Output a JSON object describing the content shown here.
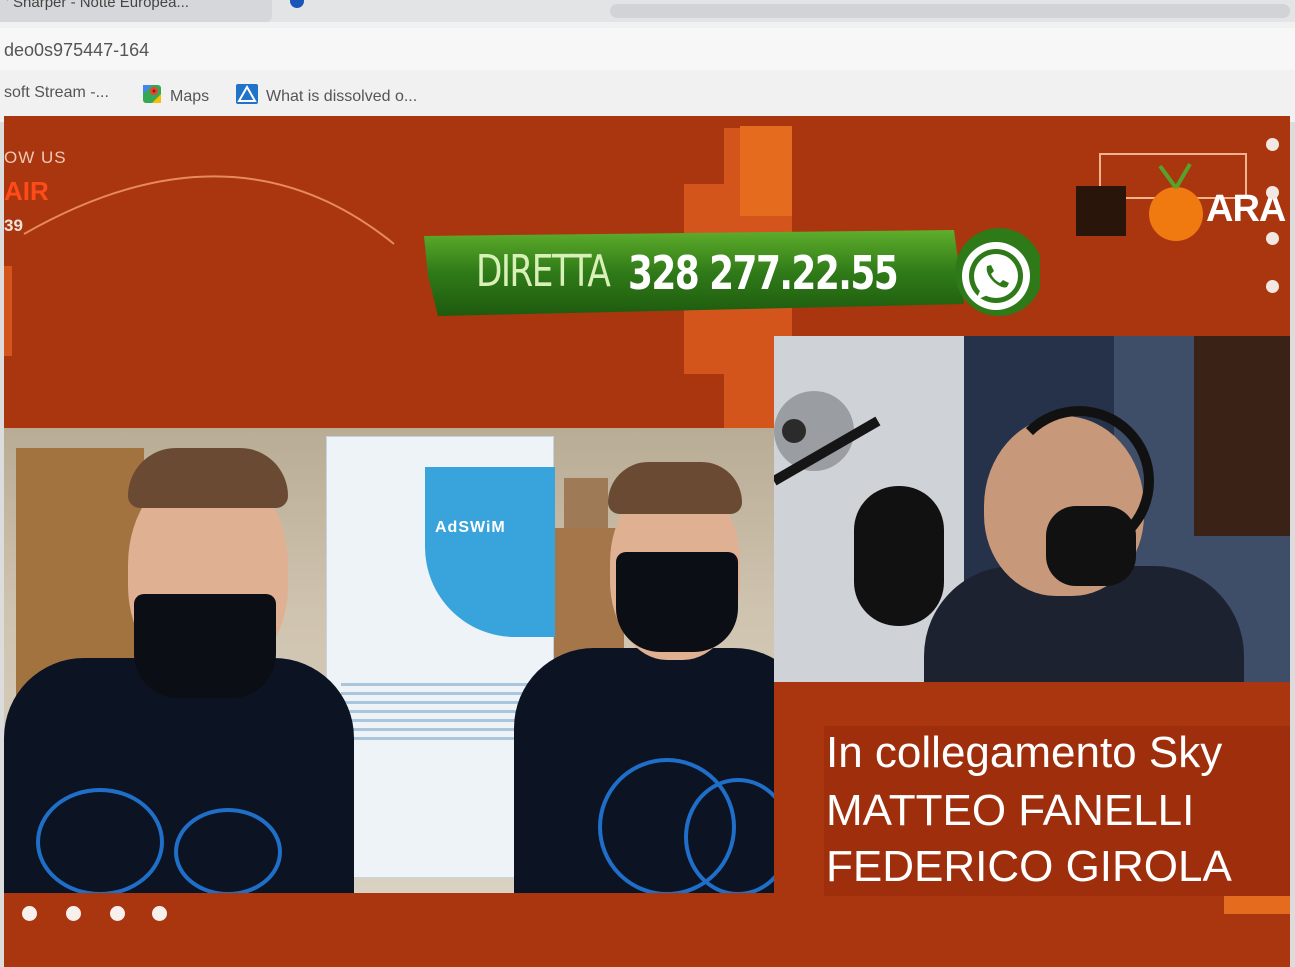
{
  "browser": {
    "tab_title": "' Sharper - Notte Europea...",
    "url": "deo0s975447-164",
    "bookmarks": [
      {
        "label": "soft Stream -...",
        "icon": "stream-icon"
      },
      {
        "label": "Maps",
        "icon": "maps-icon"
      },
      {
        "label": "What is dissolved o...",
        "icon": "triangle-logo-icon"
      }
    ]
  },
  "stream": {
    "social_label": "OW US",
    "air_label": "AIR",
    "number_label": "39",
    "banner": {
      "label": "DIRETTA",
      "number": "328 277.22.55",
      "icon": "whatsapp-icon",
      "color": "#3d8c1c"
    },
    "logo_text": "ARA",
    "poster_title": "AdSWiM",
    "captions": [
      "In collegamento Sky",
      "MATTEO FANELLI",
      "FEDERICO GIROLA"
    ],
    "colors": {
      "background": "#a9360f",
      "accent": "#e56b1f",
      "banner_green": "#3d8c1c"
    }
  }
}
